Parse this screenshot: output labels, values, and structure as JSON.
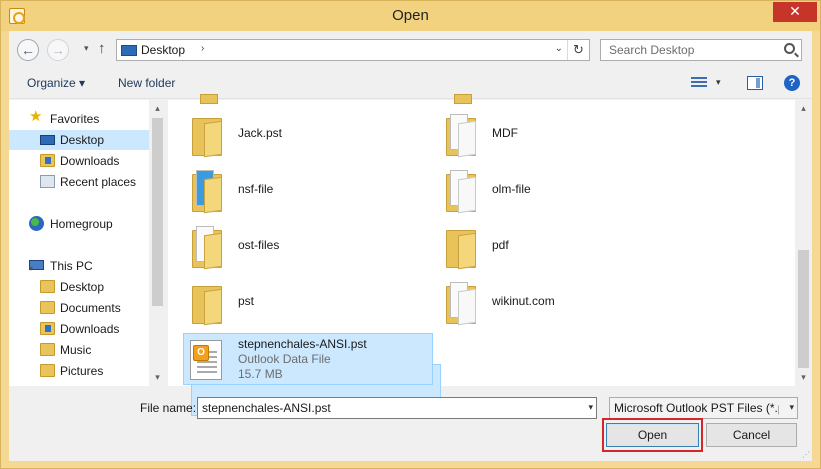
{
  "window": {
    "title": "Open",
    "close_label": "✕",
    "colors": {
      "frame": "#f2d27e",
      "close": "#c7342a",
      "selection": "#cce8ff",
      "open_highlight": "#d4262b"
    }
  },
  "nav": {
    "back_glyph": "←",
    "forward_glyph": "→",
    "recent_glyph": "▾",
    "up_glyph": "↑"
  },
  "address": {
    "location": "Desktop",
    "chevron": "›",
    "dropdown": "⌄",
    "refresh": "↻"
  },
  "search": {
    "placeholder": "Search Desktop"
  },
  "toolbar": {
    "organize_label": "Organize ▾",
    "new_folder_label": "New folder",
    "view_drop": "▾",
    "help_label": "?"
  },
  "sidebar": {
    "favorites": {
      "label": "Favorites",
      "items": [
        "Desktop",
        "Downloads",
        "Recent places"
      ]
    },
    "homegroup": "Homegroup",
    "this_pc": {
      "label": "This PC",
      "items": [
        "Desktop",
        "Documents",
        "Downloads",
        "Music",
        "Pictures"
      ]
    }
  },
  "files": [
    {
      "name": "Jack.pst",
      "type": "folder"
    },
    {
      "name": "MDF",
      "type": "folder"
    },
    {
      "name": "nsf-file",
      "type": "folder"
    },
    {
      "name": "olm-file",
      "type": "folder"
    },
    {
      "name": "ost-files",
      "type": "folder"
    },
    {
      "name": "pdf",
      "type": "folder"
    },
    {
      "name": "pst",
      "type": "folder"
    },
    {
      "name": "wikinut.com",
      "type": "folder"
    },
    {
      "name": "stepnenchales-ANSI.pst",
      "subtitle": "Outlook Data File",
      "size": "15.7 MB",
      "type": "pst",
      "selected": true
    }
  ],
  "bottom": {
    "filename_label": "File name:",
    "filename_value": "stepnenchales-ANSI.pst",
    "filetype_value": "Microsoft Outlook PST Files (*.pst)",
    "open_label": "Open",
    "cancel_label": "Cancel"
  }
}
